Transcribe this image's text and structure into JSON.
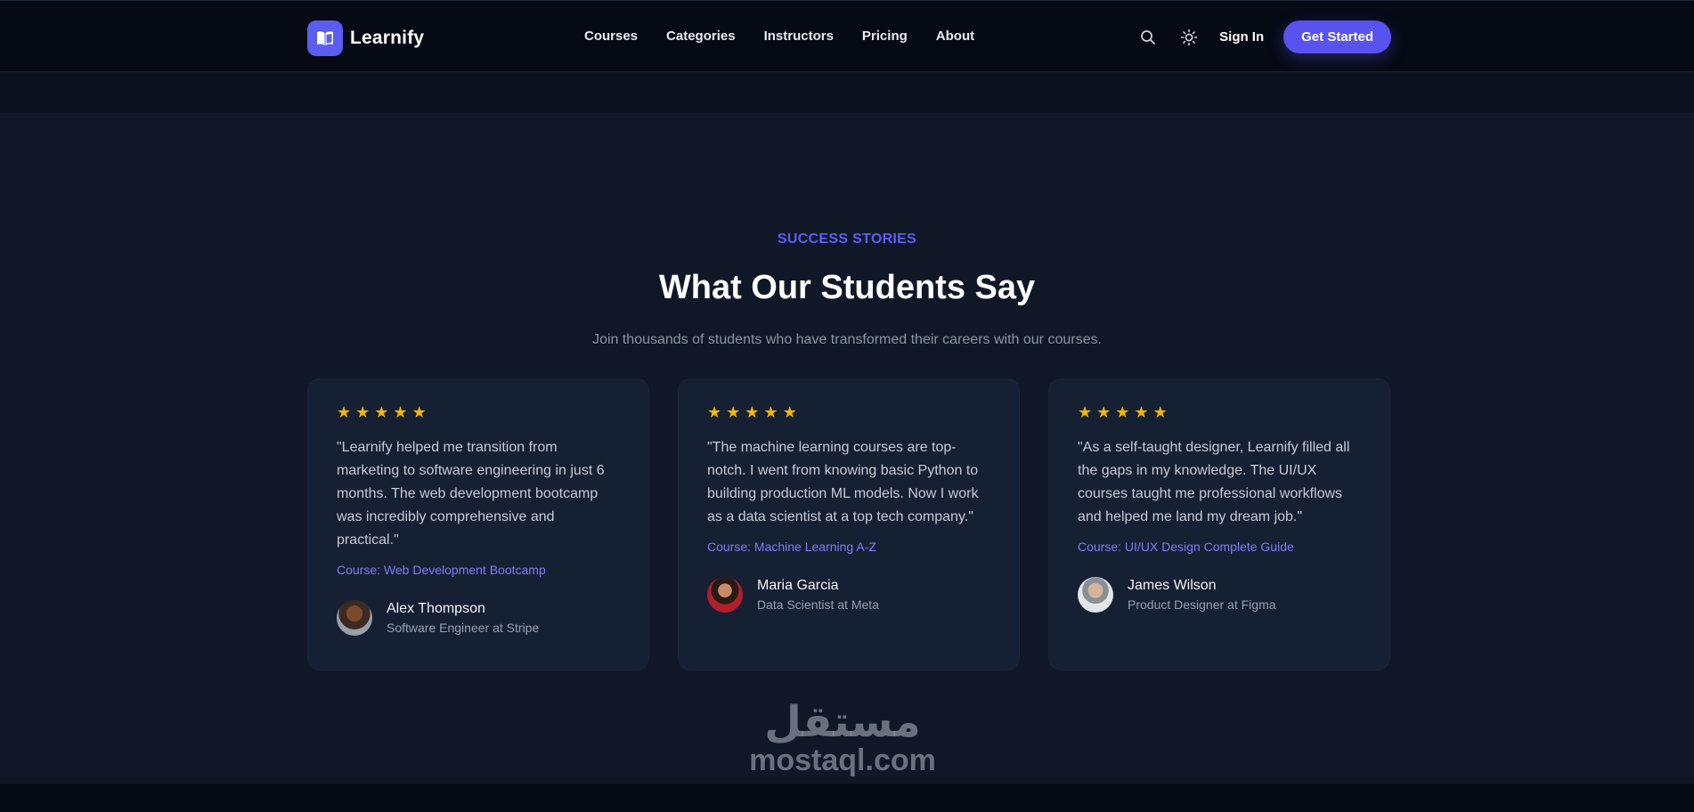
{
  "header": {
    "brand": "Learnify",
    "nav": [
      "Courses",
      "Categories",
      "Instructors",
      "Pricing",
      "About"
    ],
    "sign_in": "Sign In",
    "cta": "Get Started"
  },
  "section": {
    "eyebrow": "SUCCESS STORIES",
    "title": "What Our Students Say",
    "subtitle": "Join thousands of students who have transformed their careers with our courses."
  },
  "testimonials": [
    {
      "rating": 5,
      "quote": "\"Learnify helped me transition from marketing to software engineering in just 6 months. The web development bootcamp was incredibly comprehensive and practical.\"",
      "course": "Course: Web Development Bootcamp",
      "name": "Alex Thompson",
      "role": "Software Engineer at Stripe"
    },
    {
      "rating": 5,
      "quote": "\"The machine learning courses are top-notch. I went from knowing basic Python to building production ML models. Now I work as a data scientist at a top tech company.\"",
      "course": "Course: Machine Learning A-Z",
      "name": "Maria Garcia",
      "role": "Data Scientist at Meta"
    },
    {
      "rating": 5,
      "quote": "\"As a self-taught designer, Learnify filled all the gaps in my knowledge. The UI/UX courses taught me professional workflows and helped me land my dream job.\"",
      "course": "Course: UI/UX Design Complete Guide",
      "name": "James Wilson",
      "role": "Product Designer at Figma"
    }
  ],
  "watermark": {
    "arabic": "مستقل",
    "latin": "mostaql.com"
  },
  "colors": {
    "accent": "#5852ee",
    "star": "#f5b60a",
    "course_link": "#7b7ef7"
  }
}
